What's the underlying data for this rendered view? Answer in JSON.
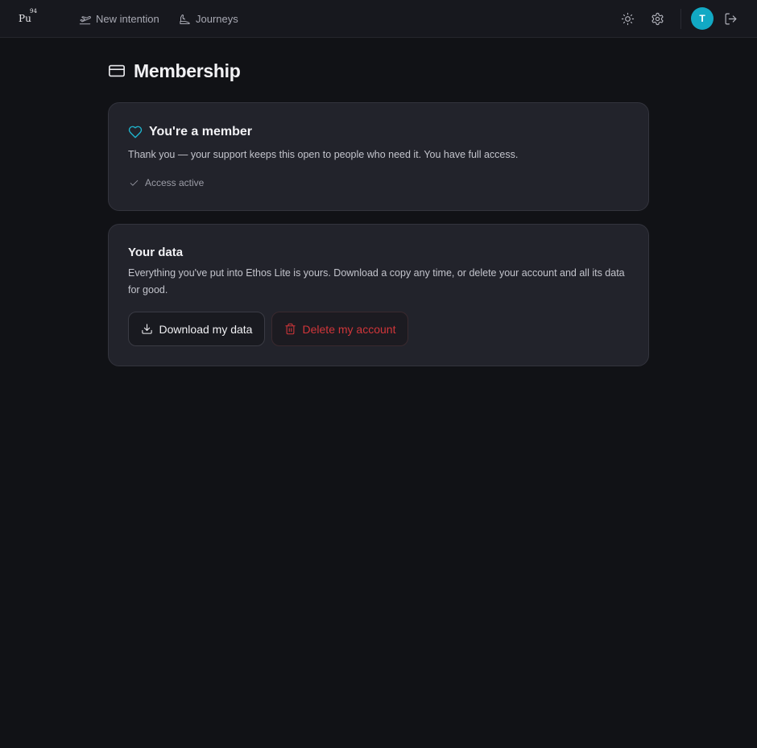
{
  "header": {
    "logo_symbol": "Pu",
    "logo_number": "94",
    "nav": [
      {
        "label": "New intention",
        "icon": "plane-takeoff-icon"
      },
      {
        "label": "Journeys",
        "icon": "footprints-icon"
      }
    ],
    "avatar_initial": "T",
    "avatar_color": "#12a9c4"
  },
  "page": {
    "title": "Membership",
    "title_icon": "credit-card-icon"
  },
  "membership_card": {
    "heading": "You're a member",
    "heading_icon": "heart-icon",
    "text": "Thank you — your support keeps this open to people who need it. You have full access.",
    "status": "Access active"
  },
  "data_card": {
    "heading": "Your data",
    "text": "Everything you've put into Ethos Lite is yours. Download a copy any time, or delete your account and all its data for good.",
    "download_label": "Download my data",
    "delete_label": "Delete my account",
    "delete_color": "#d1363a"
  }
}
